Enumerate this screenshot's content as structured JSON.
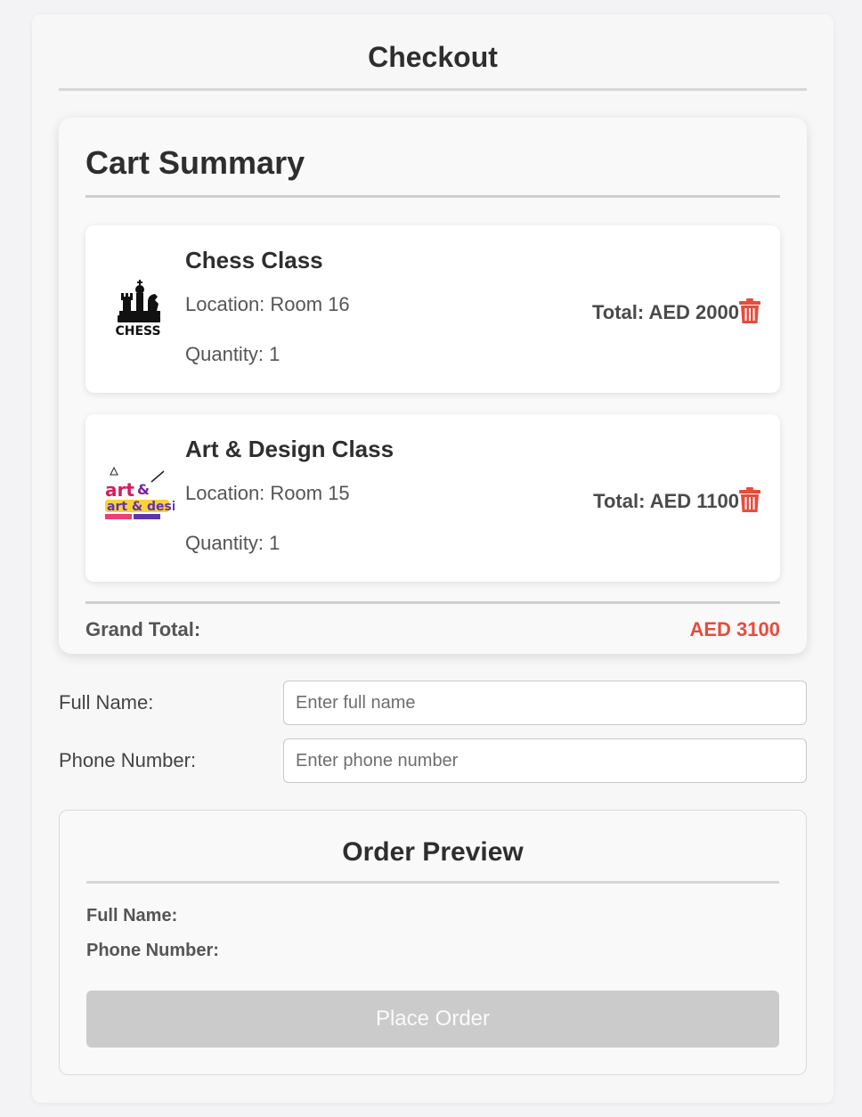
{
  "page": {
    "title": "Checkout"
  },
  "cart": {
    "title": "Cart Summary",
    "items": [
      {
        "name": "Chess Class",
        "location": "Location: Room 16",
        "quantity": "Quantity: 1",
        "total": "Total: AED 2000",
        "image_icon": "chess-logo-image",
        "image_text": "CHESS"
      },
      {
        "name": "Art & Design Class",
        "location": "Location: Room 15",
        "quantity": "Quantity: 1",
        "total": "Total: AED 1100",
        "image_icon": "art-design-logo-image",
        "image_text": "art & design"
      }
    ],
    "grand_total_label": "Grand Total:",
    "grand_total_value": "AED 3100"
  },
  "form": {
    "full_name_label": "Full Name:",
    "full_name_placeholder": "Enter full name",
    "full_name_value": "",
    "phone_label": "Phone Number:",
    "phone_placeholder": "Enter phone number",
    "phone_value": ""
  },
  "preview": {
    "title": "Order Preview",
    "full_name_label": "Full Name:",
    "phone_label": "Phone Number:",
    "place_order_label": "Place Order"
  },
  "colors": {
    "accent_total": "#e74c3c",
    "trash_icon": "#e74c3c",
    "button_disabled": "#cbcbcb"
  }
}
